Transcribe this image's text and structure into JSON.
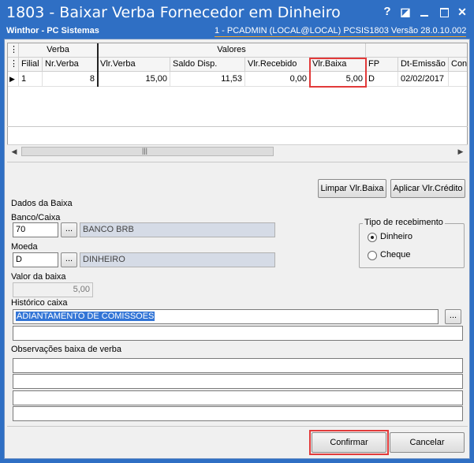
{
  "window": {
    "title": "1803 - Baixar Verba Fornecedor em Dinheiro",
    "company": "Winthor - PC Sistemas",
    "session": "1 - PCADMIN (LOCAL@LOCAL)   PCSIS1803  Versão  28.0.10.002",
    "controls": {
      "help": "?",
      "edit": "◪",
      "close": "✕"
    }
  },
  "grid": {
    "group_headers": {
      "verba": "Verba",
      "valores": "Valores"
    },
    "columns": [
      "Filial",
      "Nr.Verba",
      "Vlr.Verba",
      "Saldo Disp.",
      "Vlr.Recebido",
      "Vlr.Baixa",
      "FP",
      "Dt-Emissão",
      "Cont"
    ],
    "rows": [
      [
        "1",
        "8",
        "15,00",
        "11,53",
        "0,00",
        "5,00",
        "D",
        "02/02/2017",
        ""
      ]
    ],
    "row_indicator": "▶"
  },
  "scroll": {
    "left": "◀",
    "right": "▶",
    "grip": "|||"
  },
  "buttons": {
    "limpar": "Limpar Vlr.Baixa",
    "aplicar": "Aplicar Vlr.Crédito",
    "confirmar": "Confirmar",
    "cancelar": "Cancelar",
    "ellipsis": "..."
  },
  "form": {
    "section_title": "Dados da Baixa",
    "banco_label": "Banco/Caixa",
    "banco_code": "70",
    "banco_name": "BANCO BRB",
    "moeda_label": "Moeda",
    "moeda_code": "D",
    "moeda_name": "DINHEIRO",
    "valor_label": "Valor da baixa",
    "valor": "5,00",
    "historico_label": "Histórico caixa",
    "historico": "ADIANTAMENTO DE COMISSOES",
    "obs_label": "Observações baixa de verba"
  },
  "tipo_recebimento": {
    "title": "Tipo de recebimento",
    "options": [
      "Dinheiro",
      "Cheque"
    ],
    "selected": "Dinheiro"
  }
}
